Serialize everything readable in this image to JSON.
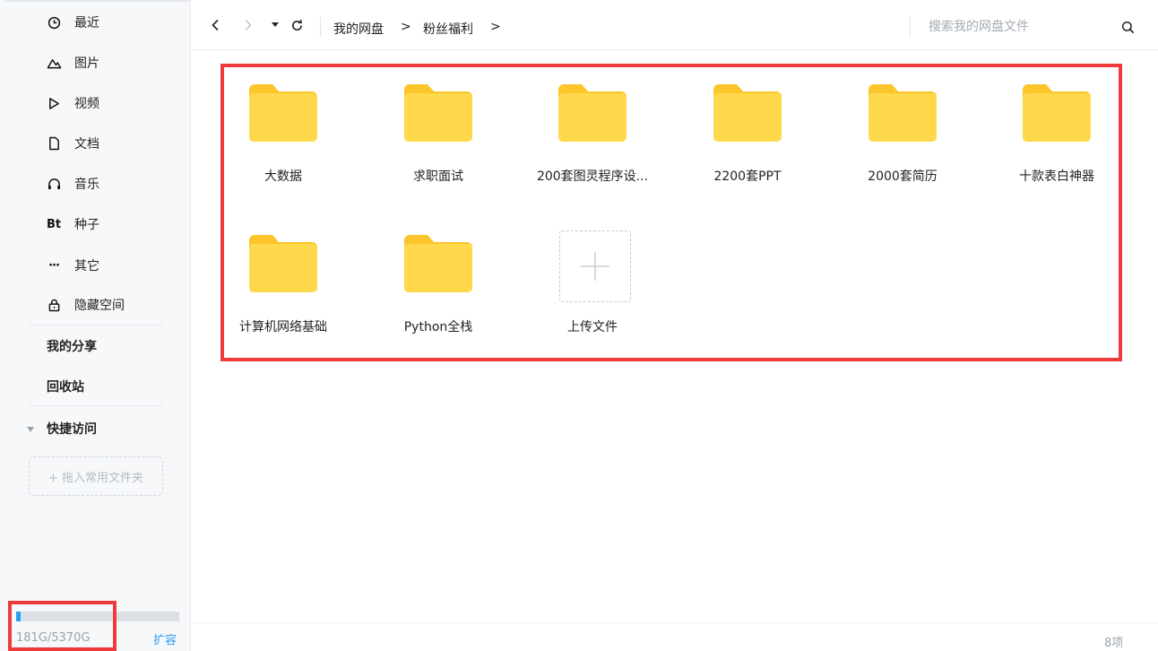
{
  "sidebar": {
    "items": [
      {
        "icon": "clock-icon",
        "label": "最近"
      },
      {
        "icon": "image-icon",
        "label": "图片"
      },
      {
        "icon": "play-icon",
        "label": "视频"
      },
      {
        "icon": "document-icon",
        "label": "文档"
      },
      {
        "icon": "headphones-icon",
        "label": "音乐"
      },
      {
        "icon": "bt-icon",
        "icon_text": "Bt",
        "label": "种子"
      },
      {
        "icon": "more-icon",
        "icon_text": "···",
        "label": "其它"
      },
      {
        "icon": "lock-icon",
        "label": "隐藏空间"
      }
    ],
    "my_share": "我的分享",
    "recycle_bin": "回收站",
    "quick_access": "快捷访问",
    "drop_hint": "+ 拖入常用文件夹",
    "storage": {
      "text": "181G/5370G",
      "used_fraction": 0.034,
      "expand_label": "扩容"
    }
  },
  "topbar": {
    "breadcrumbs": [
      "我的网盘",
      "粉丝福利"
    ],
    "crumb_separator": ">",
    "search_placeholder": "搜索我的网盘文件"
  },
  "folders": [
    {
      "name": "大数据"
    },
    {
      "name": "求职面试"
    },
    {
      "name": "200套图灵程序设..."
    },
    {
      "name": "2200套PPT"
    },
    {
      "name": "2000套简历"
    },
    {
      "name": "十款表白神器"
    },
    {
      "name": "计算机网络基础"
    },
    {
      "name": "Python全栈"
    }
  ],
  "upload": {
    "label": "上传文件"
  },
  "footer": {
    "count": "8项"
  },
  "colors": {
    "accent": "#2b9cf2",
    "folder_back": "#fcc52a",
    "folder_front": "#ffd84c",
    "highlight": "#ee3a3b"
  }
}
